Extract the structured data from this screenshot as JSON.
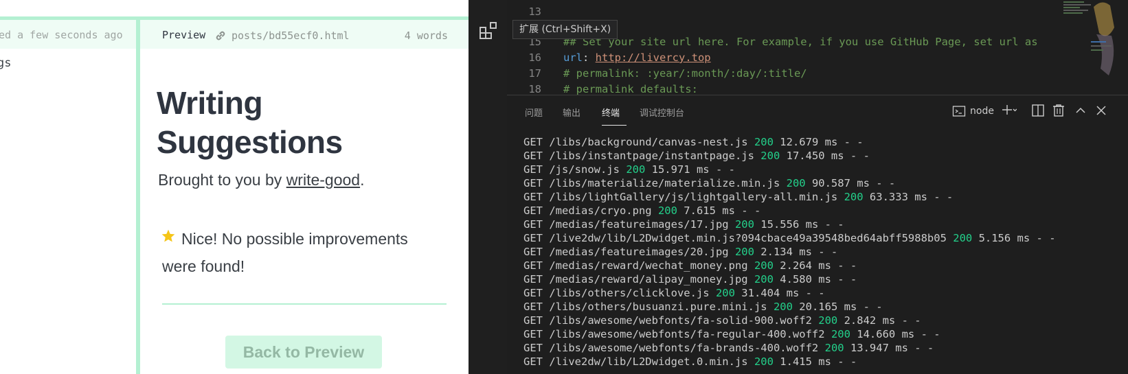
{
  "writer": {
    "editor_status": "ed a few seconds ago",
    "editor_text": "gs",
    "preview_label": "Preview",
    "preview_path": "posts/bd55ecf0.html",
    "word_count": "4 words",
    "title": "Writing Suggestions",
    "subtitle_prefix": "Brought to you by ",
    "subtitle_link": "write-good",
    "subtitle_suffix": ".",
    "result_text": "Nice! No possible improvements were found!",
    "back_button": "Back to Preview",
    "colors": {
      "accent": "#b4f0d2",
      "header_bg": "#effcf5",
      "star": "#f5c518"
    }
  },
  "vscode": {
    "tooltip": "扩展 (Ctrl+Shift+X)",
    "code": [
      {
        "ln": "13",
        "comment": "",
        "key": "",
        "sep": "",
        "url": ""
      },
      {
        "ln": "15",
        "comment": "## Set your site url here. For example, if you use GitHub Page, set url as",
        "key": "",
        "sep": "",
        "url": ""
      },
      {
        "ln": "16",
        "comment": "",
        "key": "url",
        "sep": ": ",
        "url": "http://livercy.top"
      },
      {
        "ln": "17",
        "comment": "# permalink: :year/:month/:day/:title/",
        "key": "",
        "sep": "",
        "url": ""
      },
      {
        "ln": "18",
        "comment": "# permalink_defaults:",
        "key": "",
        "sep": "",
        "url": ""
      }
    ],
    "panel_tabs": [
      "问题",
      "输出",
      "终端",
      "调试控制台"
    ],
    "active_tab": "终端",
    "shell": "node",
    "terminal": [
      {
        "path": "GET /libs/background/canvas-nest.js",
        "status": "200",
        "time": "12.679 ms - -"
      },
      {
        "path": "GET /libs/instantpage/instantpage.js",
        "status": "200",
        "time": "17.450 ms - -"
      },
      {
        "path": "GET /js/snow.js",
        "status": "200",
        "time": "15.971 ms - -"
      },
      {
        "path": "GET /libs/materialize/materialize.min.js",
        "status": "200",
        "time": "90.587 ms - -"
      },
      {
        "path": "GET /libs/lightGallery/js/lightgallery-all.min.js",
        "status": "200",
        "time": "63.333 ms - -"
      },
      {
        "path": "GET /medias/cryo.png",
        "status": "200",
        "time": "7.615 ms - -"
      },
      {
        "path": "GET /medias/featureimages/17.jpg",
        "status": "200",
        "time": "15.556 ms - -"
      },
      {
        "path": "GET /live2dw/lib/L2Dwidget.min.js?094cbace49a39548bed64abff5988b05",
        "status": "200",
        "time": "5.156 ms - -"
      },
      {
        "path": "GET /medias/featureimages/20.jpg",
        "status": "200",
        "time": "2.134 ms - -"
      },
      {
        "path": "GET /medias/reward/wechat_money.png",
        "status": "200",
        "time": "2.264 ms - -"
      },
      {
        "path": "GET /medias/reward/alipay_money.jpg",
        "status": "200",
        "time": "4.580 ms - -"
      },
      {
        "path": "GET /libs/others/clicklove.js",
        "status": "200",
        "time": "31.404 ms - -"
      },
      {
        "path": "GET /libs/others/busuanzi.pure.mini.js",
        "status": "200",
        "time": "20.165 ms - -"
      },
      {
        "path": "GET /libs/awesome/webfonts/fa-solid-900.woff2",
        "status": "200",
        "time": "2.842 ms - -"
      },
      {
        "path": "GET /libs/awesome/webfonts/fa-regular-400.woff2",
        "status": "200",
        "time": "14.660 ms - -"
      },
      {
        "path": "GET /libs/awesome/webfonts/fa-brands-400.woff2",
        "status": "200",
        "time": "13.947 ms - -"
      },
      {
        "path": "GET /live2dw/lib/L2Dwidget.0.min.js",
        "status": "200",
        "time": "1.415 ms - -"
      }
    ]
  }
}
